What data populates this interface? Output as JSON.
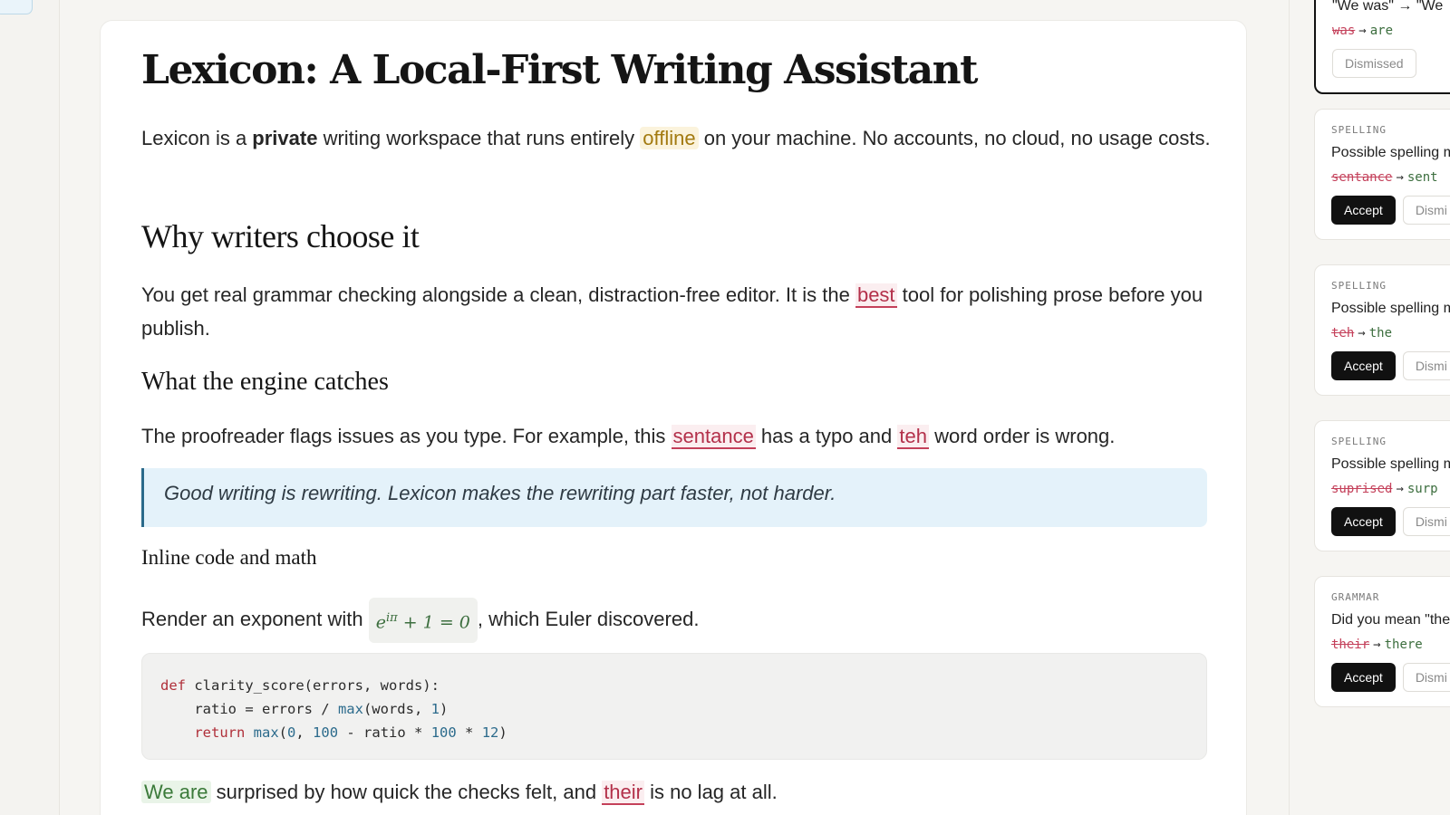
{
  "document": {
    "title": "Lexicon: A Local-First Writing Assistant",
    "intro": {
      "t1": "Lexicon is a ",
      "bold": "private",
      "t2": " writing workspace that runs entirely ",
      "hl": "offline",
      "t3": " on your machine. No accounts, no cloud, no usage costs."
    },
    "h2": "Why writers choose it",
    "p2": {
      "t1": "You get real grammar checking alongside a clean, distraction-free editor. It is the ",
      "flag": "best",
      "t2": " tool for polishing prose before you publish."
    },
    "h3": "What the engine catches",
    "p3": {
      "t1": "The proofreader flags issues as you type. For example, this ",
      "flag1": "sentance",
      "t2": " has a typo and ",
      "flag2": "teh",
      "t3": " word order is wrong."
    },
    "quote": "Good writing is rewriting. Lexicon makes the rewriting part faster, not harder.",
    "h4": "Inline code and math",
    "p4": {
      "t1": "Render an exponent with ",
      "math_base": "e",
      "math_exp": "iπ",
      "math_rest": " + 1 = 0",
      "t2": ", which Euler discovered."
    },
    "code": {
      "l1_kw": "def",
      "l1_rest": " clarity_score(errors, words):",
      "l2_a": "    ratio = errors / ",
      "l2_fn": "max",
      "l2_b": "(words, ",
      "l2_num": "1",
      "l2_c": ")",
      "l3_kw": "    return",
      "l3_sp": " ",
      "l3_fn": "max",
      "l3_a": "(",
      "l3_n1": "0",
      "l3_b": ", ",
      "l3_n2": "100",
      "l3_c": " - ratio * ",
      "l3_n3": "100",
      "l3_d": " * ",
      "l3_n4": "12",
      "l3_e": ")"
    },
    "p5": {
      "flag_we": "We are",
      "t1": " surprised by how quick the checks felt, and ",
      "flag": "their",
      "t2": " is no lag at all."
    }
  },
  "suggestions": [
    {
      "message": "\"We was\" → \"We",
      "old": "was",
      "new": "are",
      "dismiss": "Dismissed"
    },
    {
      "category": "SPELLING",
      "message": "Possible spelling m",
      "old": "sentance",
      "new": "sent",
      "accept": "Accept",
      "dismiss": "Dismi"
    },
    {
      "category": "SPELLING",
      "message": "Possible spelling m",
      "old": "teh",
      "new": "the",
      "accept": "Accept",
      "dismiss": "Dismi"
    },
    {
      "category": "SPELLING",
      "message": "Possible spelling m",
      "old": "suprised",
      "new": "surp",
      "accept": "Accept",
      "dismiss": "Dismi"
    },
    {
      "category": "GRAMMAR",
      "message": "Did you mean \"the",
      "old": "their",
      "new": "there",
      "accept": "Accept",
      "dismiss": "Dismi"
    }
  ],
  "arrow": "→",
  "colors": {
    "flag_error": "#c4405a",
    "fix_new": "#3c6e3e",
    "quote_bg": "#e4f2fa",
    "accent_dark": "#111111"
  }
}
